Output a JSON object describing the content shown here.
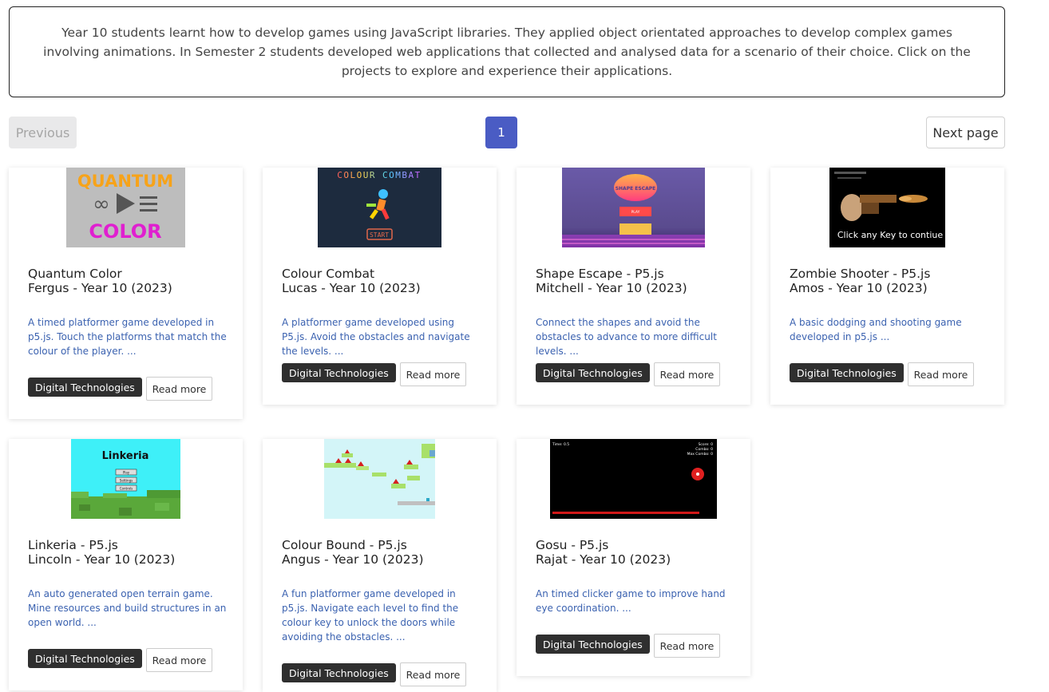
{
  "intro": {
    "text": "Year 10 students learnt how to develop games using JavaScript libraries. They applied object orientated approaches to develop complex games involving animations. In Semester 2 students developed web applications that collected and analysed data for a scenario of their choice. Click on the projects to explore and experience their applications."
  },
  "pagination": {
    "previous_label": "Previous",
    "current_page": "1",
    "next_label": "Next page"
  },
  "badge_label": "Digital Technologies",
  "read_more_label": "Read more",
  "cards": [
    {
      "title": "Quantum Color",
      "author": "Fergus - Year 10 (2023)",
      "description": "A timed platformer game developed in p5.js. Touch the platforms that match the colour of the player. ...",
      "thumb": {
        "line1": "QUANTUM",
        "line2": "COLOR"
      }
    },
    {
      "title": "Colour Combat",
      "author": "Lucas - Year 10 (2023)",
      "description": "A platformer game developed using P5.js. Avoid the obstacles and navigate the levels. ...",
      "thumb": {
        "heading": "COLOUR COMBAT",
        "button": "START"
      }
    },
    {
      "title": "Shape Escape - P5.js",
      "author": "Mitchell - Year 10 (2023)",
      "description": "Connect the shapes and avoid the obstacles to advance to more difficult levels. ...",
      "thumb": {
        "logo": "SHAPE ESCAPE",
        "button": "PLAY"
      }
    },
    {
      "title": "Zombie Shooter - P5.js",
      "author": "Amos - Year 10 (2023)",
      "description": "A basic dodging and shooting game developed in p5.js ...",
      "thumb": {
        "caption": "Click any Key to contiue"
      }
    },
    {
      "title": "Linkeria - P5.js",
      "author": "Lincoln - Year 10 (2023)",
      "description": "An auto generated open terrain game. Mine resources and build structures in an open world. ...",
      "thumb": {
        "heading": "Linkeria",
        "menu": [
          "Play",
          "Settings",
          "Controls"
        ]
      }
    },
    {
      "title": "Colour Bound - P5.js",
      "author": "Angus - Year 10 (2023)",
      "description": "A fun platformer game developed in p5.js. Navigate each level to find the colour key to unlock the doors while avoiding the obstacles. ...",
      "thumb": {}
    },
    {
      "title": "Gosu - P5.js",
      "author": "Rajat - Year 10 (2023)",
      "description": "An timed clicker game to improve hand eye coordination. ...",
      "thumb": {
        "time": "Time: 0.5",
        "score": "Score: 0",
        "combo": "Combo: 0",
        "max_combo": "Max Combo: 0"
      }
    }
  ]
}
